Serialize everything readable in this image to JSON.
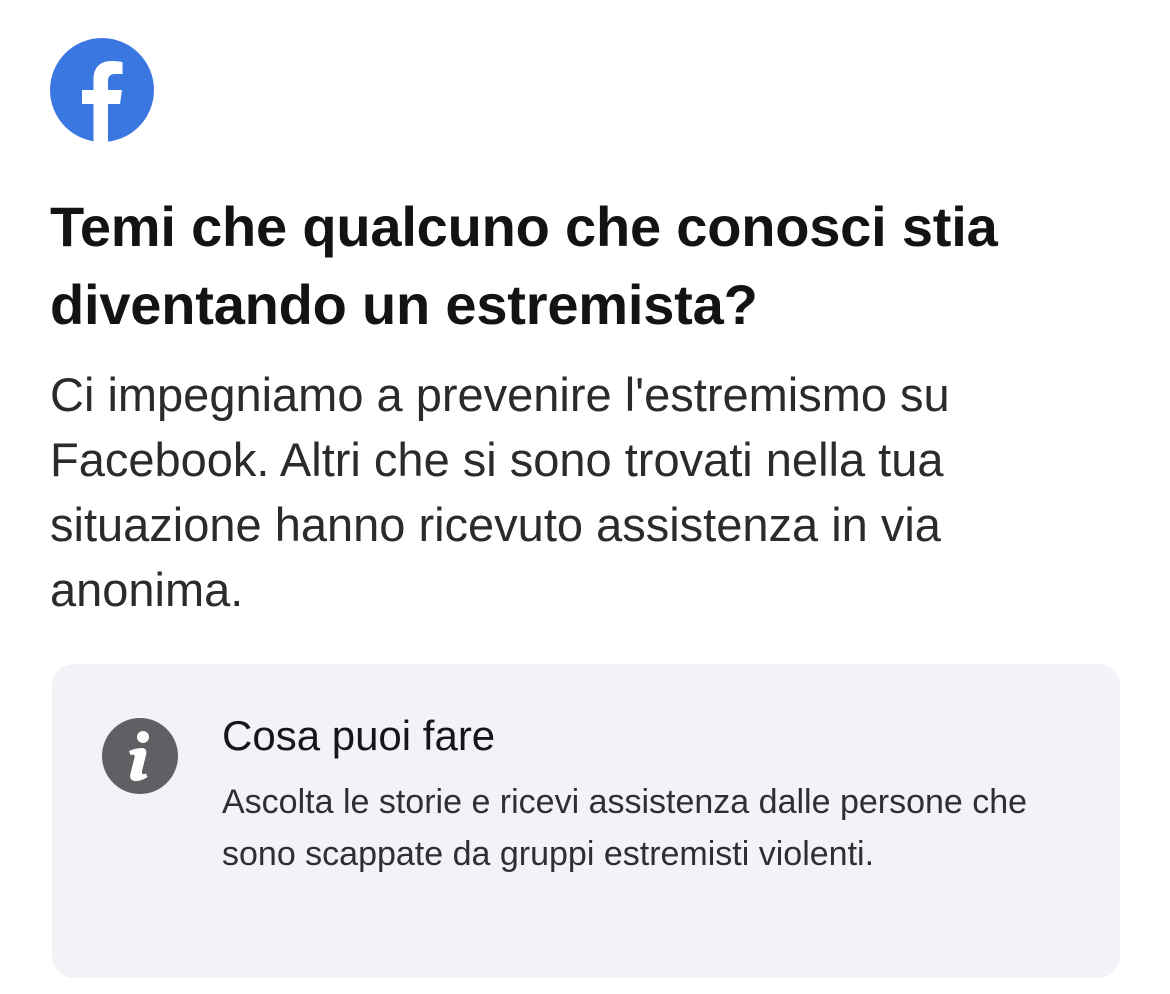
{
  "brand": {
    "logo_icon": "facebook-logo-icon",
    "logo_color": "#3b77e1"
  },
  "header": {
    "title": "Temi che qualcuno che conosci stia diventando un estremista?"
  },
  "main": {
    "body": "Ci impegniamo a prevenire l'estremismo su Facebook. Altri che si sono trovati nella tua situazione hanno ricevuto assistenza in via anonima."
  },
  "info_card": {
    "icon": "info-icon",
    "icon_color": "#5f6064",
    "background": "#f2f3f7",
    "title": "Cosa puoi fare",
    "description": "Ascolta le storie e ricevi assistenza dalle persone che sono scappate da gruppi estremisti violenti."
  }
}
